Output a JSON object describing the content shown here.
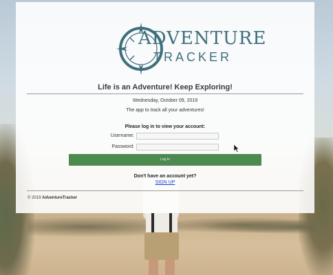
{
  "logo": {
    "line1": "ADVENTURE",
    "line2": "TRACKER",
    "icon": "compass-icon",
    "color": "#3f6f7a"
  },
  "tagline": "Life is an Adventure! Keep Exploring!",
  "date": "Wednesday, October 09, 2019",
  "subtitle": "The app to track all your adventures!",
  "login": {
    "prompt": "Please log in to view your account:",
    "username_label": "Username:",
    "username_value": "",
    "password_label": "Password:",
    "password_value": "",
    "button_label": "Log In",
    "button_color": "#4d8a4f"
  },
  "signup": {
    "question": "Don't have an account yet?",
    "link_label": "SIGN UP"
  },
  "footer": {
    "copyright": "© 2019",
    "brand": "AdventureTracker"
  }
}
